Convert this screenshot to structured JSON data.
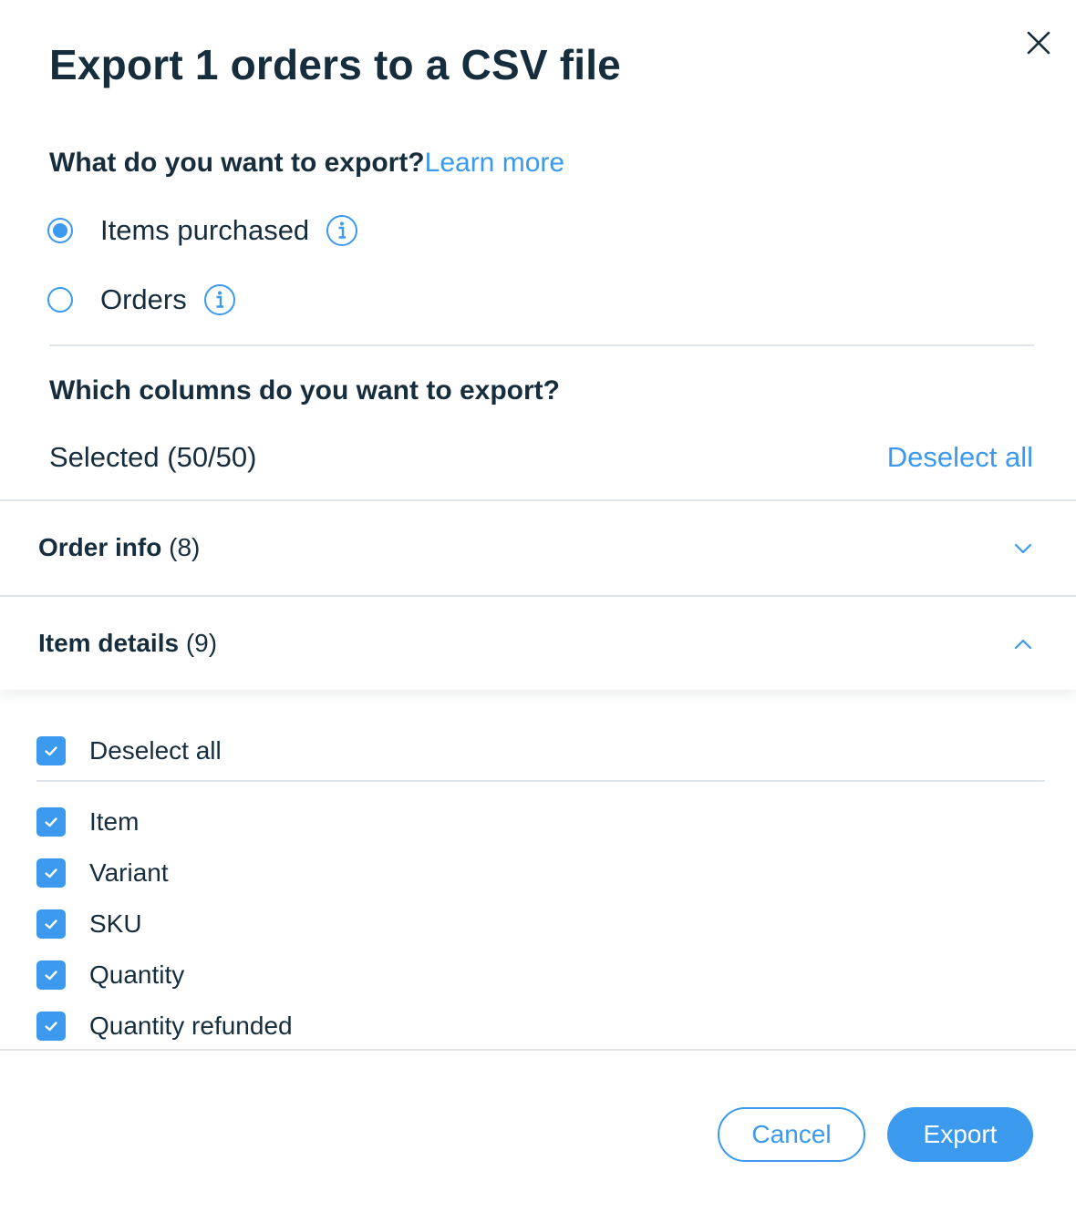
{
  "dialog": {
    "title": "Export 1 orders to a CSV file",
    "close_icon": "close-icon"
  },
  "export_type": {
    "question": "What do you want to export?",
    "learn_more": "Learn more",
    "options": [
      {
        "label": "Items purchased",
        "selected": true,
        "icon": "info-icon"
      },
      {
        "label": "Orders",
        "selected": false,
        "icon": "info-icon"
      }
    ]
  },
  "columns": {
    "question": "Which columns do you want to export?",
    "selected_text": "Selected (50/50)",
    "deselect_all": "Deselect all"
  },
  "sections": [
    {
      "title": "Order info",
      "count": "(8)",
      "expanded": false,
      "icon": "chevron-down-icon"
    },
    {
      "title": "Item details",
      "count": "(9)",
      "expanded": true,
      "icon": "chevron-up-icon"
    }
  ],
  "item_details": {
    "select_all_label": "Deselect all",
    "items": [
      {
        "label": "Item",
        "checked": true
      },
      {
        "label": "Variant",
        "checked": true
      },
      {
        "label": "SKU",
        "checked": true
      },
      {
        "label": "Quantity",
        "checked": true
      },
      {
        "label": "Quantity refunded",
        "checked": true
      }
    ]
  },
  "footer": {
    "cancel": "Cancel",
    "export": "Export"
  },
  "colors": {
    "accent": "#3b99ee",
    "text": "#162d3d",
    "divider": "#dfe5eb"
  }
}
